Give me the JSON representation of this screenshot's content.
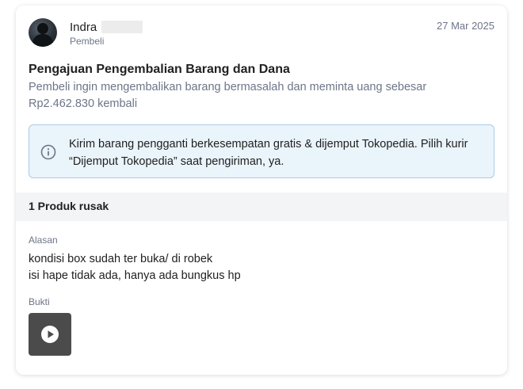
{
  "header": {
    "name": "Indra",
    "role": "Pembeli",
    "date": "27 Mar 2025"
  },
  "request": {
    "title": "Pengajuan Pengembalian Barang dan Dana",
    "description": "Pembeli ingin mengembalikan barang bermasalah dan meminta uang sebesar Rp2.462.830 kembali"
  },
  "info_banner": {
    "icon": "info-icon",
    "text": "Kirim barang pengganti berkesempatan gratis & dijemput Tokopedia. Pilih kurir “Dijemput Tokopedia” saat pengiriman, ya."
  },
  "product_section": {
    "title": "1 Produk rusak"
  },
  "reason": {
    "label": "Alasan",
    "line1": "kondisi box sudah ter buka/ di robek",
    "line2": "isi hape tidak ada, hanya ada bungkus hp"
  },
  "evidence": {
    "label": "Bukti",
    "icon": "play-icon"
  },
  "colors": {
    "text_primary": "#212121",
    "text_secondary": "#6d7588",
    "info_bg": "#eaf4fb",
    "info_border": "#a9cce8",
    "section_bg": "#f3f4f5",
    "thumb_bg": "#4b4b4b"
  }
}
